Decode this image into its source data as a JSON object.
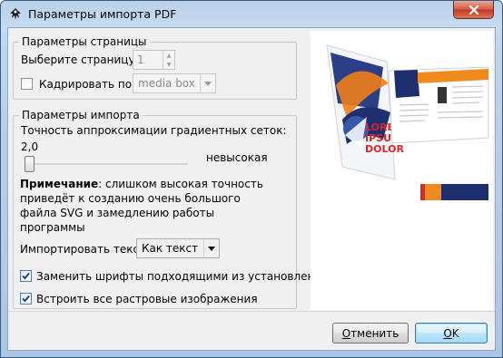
{
  "window": {
    "title": "Параметры импорта PDF",
    "app_icon": "inkscape-icon",
    "close_icon": "close-icon"
  },
  "page_settings": {
    "legend": "Параметры страницы",
    "select_page_label": "Выберите страницу:",
    "page_value": "1",
    "crop_label": "Кадрировать по:",
    "crop_checked": false,
    "crop_value": "media box"
  },
  "import_settings": {
    "legend": "Параметры импорта",
    "precision_label": "Точность аппроксимации градиентных сеток:",
    "precision_value": "2,0",
    "precision_level": 0.0,
    "precision_desc": "невысокая",
    "note_bold": "Примечание",
    "note_lines": [
      ": слишком высокая точность",
      "приведёт к созданию очень большого",
      "файла SVG и замедлению работы",
      "программы"
    ],
    "import_text_label": "Импортировать текст:",
    "import_text_value": "Как текст",
    "replace_fonts_label": "Заменить шрифты подходящими из установленных",
    "replace_fonts_checked": true,
    "embed_images_label": "Встроить все растровые изображения",
    "embed_images_checked": true
  },
  "preview": {
    "brochure_text": [
      "LOREM",
      "IPSUM",
      "DOLOR"
    ]
  },
  "buttons": {
    "cancel_prefix": "",
    "cancel_mnemonic": "О",
    "cancel_rest": "тменить",
    "ok_mnemonic": "О",
    "ok_rest": "K"
  },
  "colors": {
    "brochure_red": "#d9262b",
    "brochure_navy": "#1d2f6f",
    "brochure_orange": "#f08a1c"
  }
}
